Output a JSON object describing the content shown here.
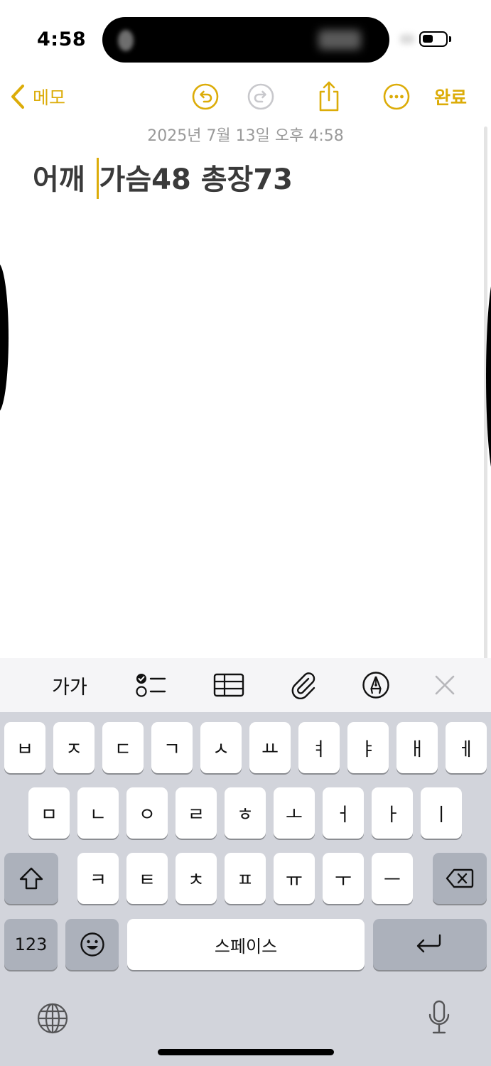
{
  "status_bar": {
    "time": "4:58"
  },
  "nav": {
    "back_label": "메모",
    "done_label": "완료"
  },
  "note": {
    "date": "2025년 7월 13일 오후 4:58",
    "text_before_cursor": "어깨 ",
    "text_after_cursor": "가슴48 총장73"
  },
  "toolbar": {
    "format_label": "가가"
  },
  "keyboard": {
    "row1": [
      "ㅂ",
      "ㅈ",
      "ㄷ",
      "ㄱ",
      "ㅅ",
      "ㅛ",
      "ㅕ",
      "ㅑ",
      "ㅐ",
      "ㅔ"
    ],
    "row2": [
      "ㅁ",
      "ㄴ",
      "ㅇ",
      "ㄹ",
      "ㅎ",
      "ㅗ",
      "ㅓ",
      "ㅏ",
      "ㅣ"
    ],
    "row3": [
      "ㅋ",
      "ㅌ",
      "ㅊ",
      "ㅍ",
      "ㅠ",
      "ㅜ",
      "ㅡ"
    ],
    "numbers_label": "123",
    "space_label": "스페이스"
  },
  "colors": {
    "accent": "#dcac08",
    "keyboard_bg": "#d2d4db",
    "function_key": "#acb1bb"
  }
}
